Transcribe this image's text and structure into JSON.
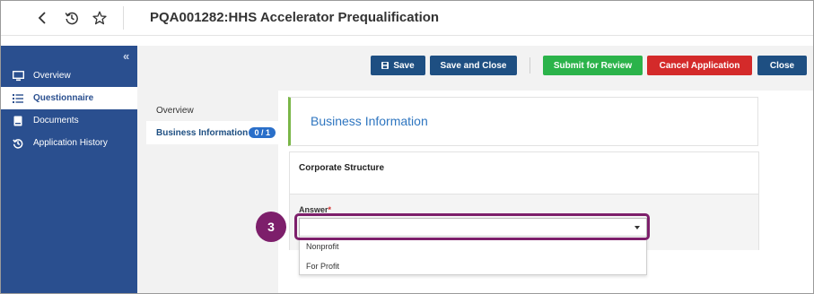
{
  "header": {
    "title": "PQA001282:HHS Accelerator Prequalification",
    "icons": [
      "chevron-left-icon",
      "history-icon",
      "star-icon"
    ]
  },
  "sidebar": {
    "collapse_label": "«",
    "items": [
      {
        "label": "Overview",
        "icon": "monitor-icon",
        "active": false
      },
      {
        "label": "Questionnaire",
        "icon": "list-icon",
        "active": true
      },
      {
        "label": "Documents",
        "icon": "document-icon",
        "active": false
      },
      {
        "label": "Application History",
        "icon": "history-icon",
        "active": false
      }
    ]
  },
  "toolbar": {
    "save_label": "Save",
    "save_close_label": "Save and Close",
    "submit_label": "Submit for Review",
    "cancel_label": "Cancel Application",
    "close_label": "Close"
  },
  "subnav": {
    "items": [
      {
        "label": "Overview",
        "active": false
      },
      {
        "label": "Business Information",
        "active": true,
        "badge": "0 / 1"
      }
    ]
  },
  "section": {
    "title": "Business Information"
  },
  "question": {
    "title": "Corporate Structure",
    "answer_label": "Answer",
    "required_mark": "*",
    "selected_value": "",
    "options": [
      "Nonprofit",
      "For Profit"
    ]
  },
  "annotation": {
    "step_number": "3"
  },
  "colors": {
    "sidebar_bg": "#2a4f8f",
    "primary_button": "#1e4f82",
    "submit_button": "#2bb34a",
    "cancel_button": "#d42a2a",
    "section_title": "#2f76c0",
    "section_accent": "#7ab648",
    "highlight": "#7d1f6b",
    "badge": "#2a6fc9"
  }
}
